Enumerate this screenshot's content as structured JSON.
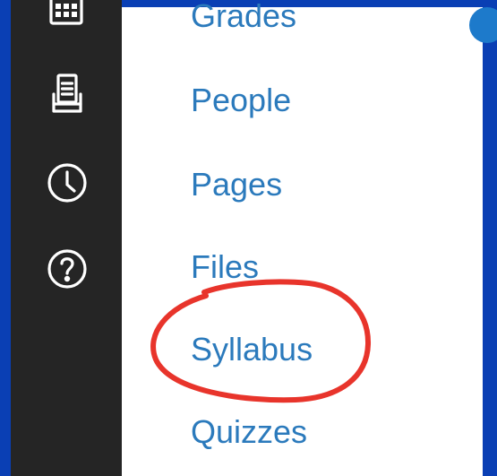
{
  "global_nav": {
    "icons": [
      "calendar-grid-icon",
      "inbox-tray-icon",
      "history-clock-icon",
      "help-question-icon"
    ]
  },
  "course_nav": {
    "items": [
      {
        "label": "Grades"
      },
      {
        "label": "People"
      },
      {
        "label": "Pages"
      },
      {
        "label": "Files"
      },
      {
        "label": "Syllabus"
      },
      {
        "label": "Quizzes"
      }
    ]
  },
  "colors": {
    "frame_blue": "#0a3fb4",
    "nav_dark": "#252525",
    "link_blue": "#2b7abc",
    "annotation_red": "#e8342b"
  },
  "annotation": {
    "type": "hand-drawn circle",
    "target": "Syllabus"
  }
}
